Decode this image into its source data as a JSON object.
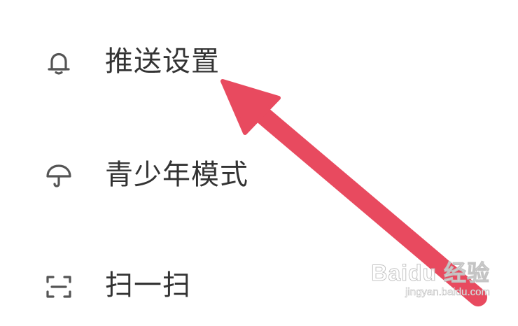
{
  "menu": {
    "items": [
      {
        "id": "push",
        "label": "推送设置",
        "icon": "bell-icon"
      },
      {
        "id": "teen",
        "label": "青少年模式",
        "icon": "umbrella-icon"
      },
      {
        "id": "scan",
        "label": "扫一扫",
        "icon": "scan-icon"
      }
    ]
  },
  "annotation": {
    "type": "arrow",
    "color": "#e84a5f",
    "points_to": "推送设置"
  },
  "watermark": {
    "logo": "Baidu 经验",
    "url": "jingyan.baidu.com"
  },
  "colors": {
    "text": "#333333",
    "icon": "#555555",
    "background": "#ffffff",
    "arrow": "#e84a5f"
  }
}
